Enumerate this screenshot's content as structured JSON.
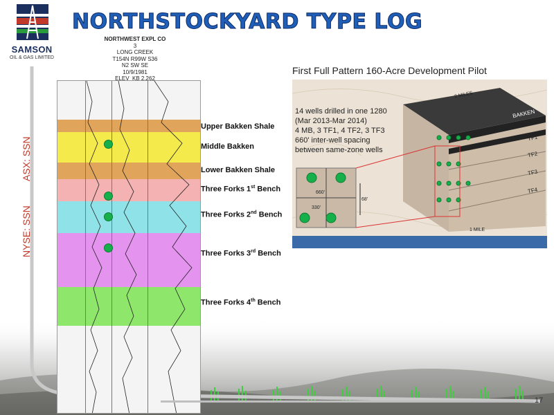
{
  "company": {
    "name": "SAMSON",
    "subtitle": "OIL & GAS LIMITED"
  },
  "slide": {
    "title": "NORTHSTOCKYARD TYPE LOG",
    "page_number": "17"
  },
  "tickers": {
    "asx": "ASX: SSN",
    "nyse": "NYSE: SSN"
  },
  "log_header": [
    "NORTHWEST EXPL CO",
    "3",
    "LONG CREEK",
    "T154N R99W S36",
    "N2 SW SE",
    "10/9/1981",
    "ELEV_KB 2,262"
  ],
  "zones": [
    {
      "name": "Upper Bakken Shale",
      "sup": "",
      "suffix": "",
      "color": "#e0a45a",
      "has_dot": false
    },
    {
      "name": "Middle Bakken",
      "sup": "",
      "suffix": "",
      "color": "#f4ea4c",
      "has_dot": true
    },
    {
      "name": "Lower Bakken Shale",
      "sup": "",
      "suffix": "",
      "color": "#e0a45a",
      "has_dot": false
    },
    {
      "name": "Three Forks 1",
      "sup": "st",
      "suffix": " Bench",
      "color": "#f5b2b2",
      "has_dot": true
    },
    {
      "name": "Three Forks 2",
      "sup": "nd",
      "suffix": " Bench",
      "color": "#8fe3e8",
      "has_dot": true
    },
    {
      "name": "Three Forks 3",
      "sup": "rd",
      "suffix": "  Bench",
      "color": "#e493ee",
      "has_dot": true
    },
    {
      "name": "Three Forks 4",
      "sup": "th",
      "suffix": " Bench",
      "color": "#8ee66b",
      "has_dot": false
    }
  ],
  "pilot": {
    "title": "First Full Pattern 160-Acre Development Pilot",
    "lines": [
      "14 wells drilled in one 1280",
      "(Mar 2013-Mar 2014)",
      "4 MB, 3 TF1, 4 TF2, 3 TF3",
      "660' inter-well spacing",
      "between same-zone wells"
    ],
    "block_labels": {
      "top": "2 MILES",
      "bottom": "1 MILE",
      "bakken": "BAKKEN",
      "tf1": "TF1",
      "tf2": "TF2",
      "tf3": "TF3",
      "tf4": "TF4"
    },
    "inset": {
      "horizontal": "660'",
      "offset": "330'",
      "vertical": "68'"
    }
  },
  "colors": {
    "title": "#1f5fb8",
    "ticker": "#c0392b",
    "well_dot": "#16b04a",
    "accent": "#1b2f5e"
  }
}
